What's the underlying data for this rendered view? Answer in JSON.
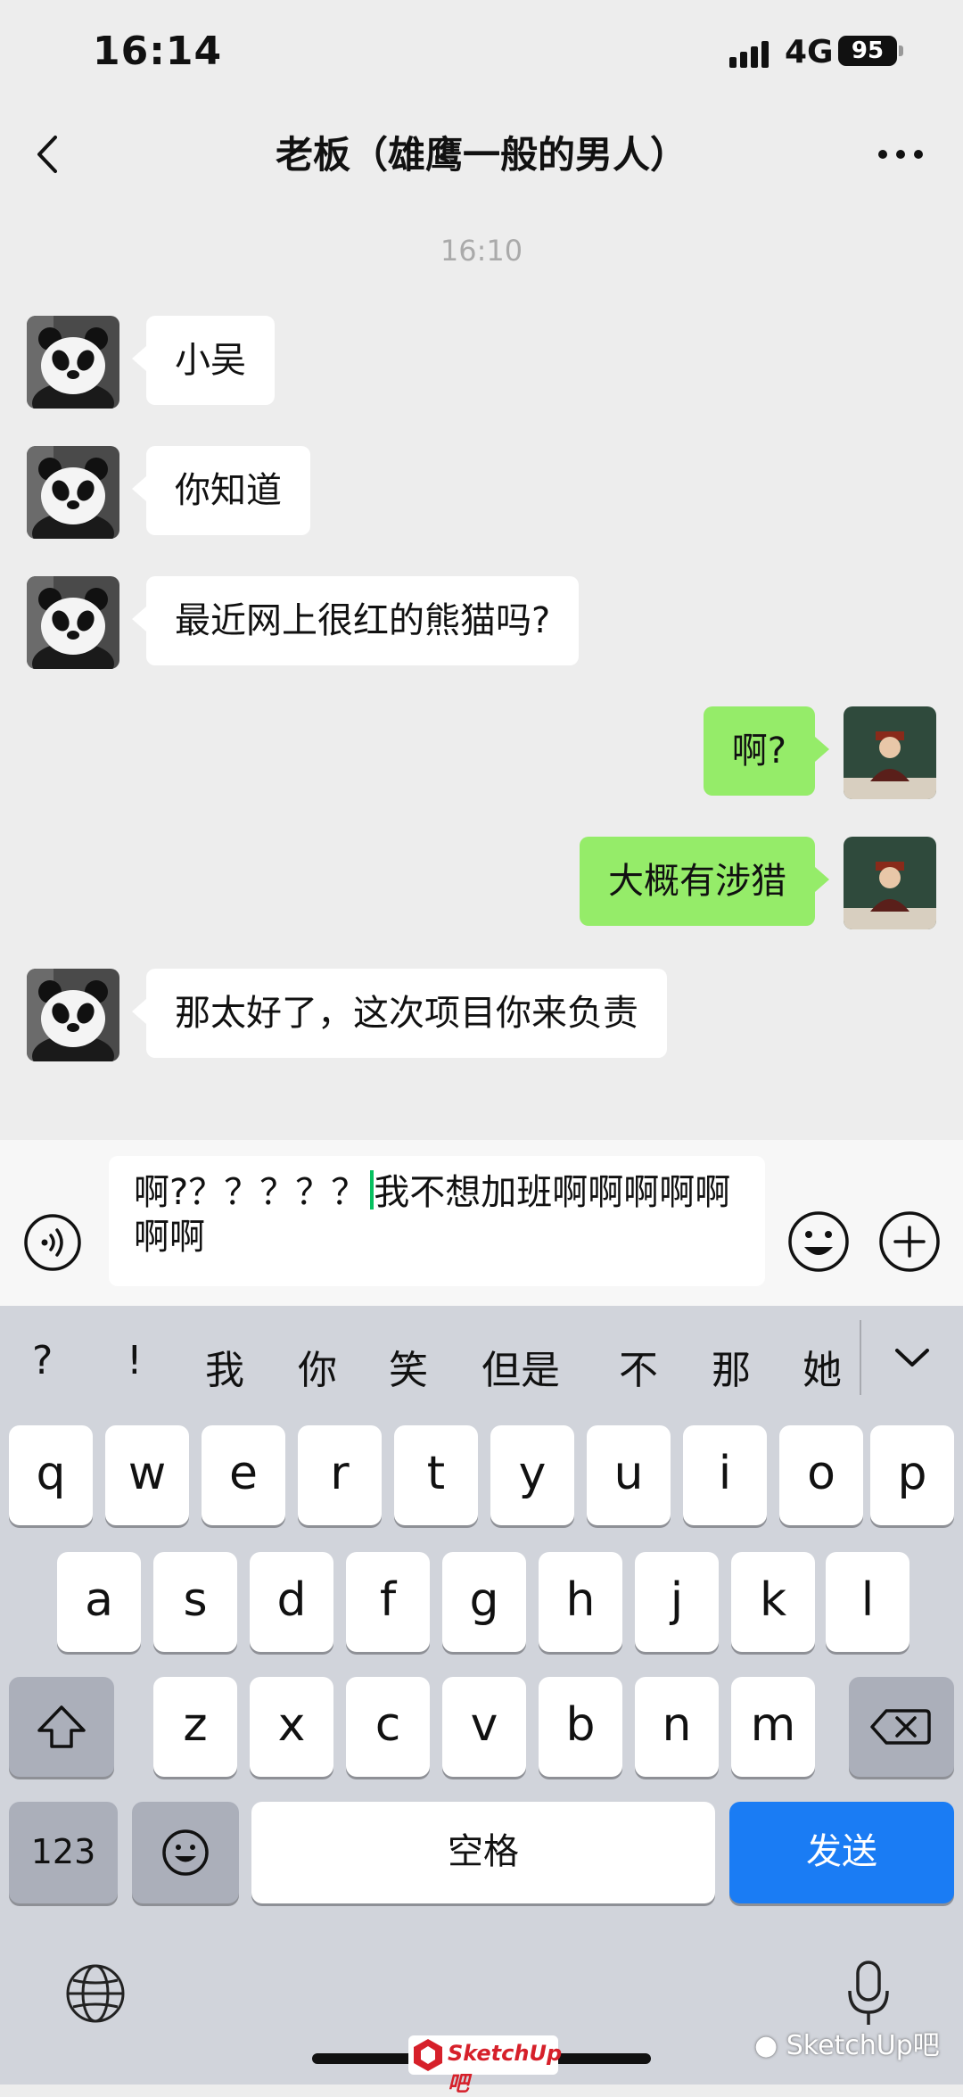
{
  "status_bar": {
    "time": "16:14",
    "network": "4G",
    "battery": "95"
  },
  "nav": {
    "title": "老板（雄鹰一般的男人）",
    "back_icon": "chevron-left-icon",
    "more_icon": "more-dots-icon"
  },
  "chat": {
    "timestamp": "16:10",
    "messages": [
      {
        "from": "contact",
        "text": "小吴"
      },
      {
        "from": "contact",
        "text": "你知道"
      },
      {
        "from": "contact",
        "text": "最近网上很红的熊猫吗?"
      },
      {
        "from": "me",
        "text": "啊?"
      },
      {
        "from": "me",
        "text": "大概有涉猎"
      },
      {
        "from": "contact",
        "text": "那太好了，这次项目你来负责"
      }
    ]
  },
  "input": {
    "before_cursor": "啊?？？？？？",
    "after_cursor": "我不想加班啊啊啊啊啊啊啊"
  },
  "keyboard": {
    "candidates": [
      "?",
      "!",
      "我",
      "你",
      "笑",
      "但是",
      "不",
      "那",
      "她"
    ],
    "row1": [
      "q",
      "w",
      "e",
      "r",
      "t",
      "y",
      "u",
      "i",
      "o",
      "p"
    ],
    "row2": [
      "a",
      "s",
      "d",
      "f",
      "g",
      "h",
      "j",
      "k",
      "l"
    ],
    "row3": [
      "z",
      "x",
      "c",
      "v",
      "b",
      "n",
      "m"
    ],
    "numbers_label": "123",
    "space_label": "空格",
    "send_label": "发送",
    "send_color": "#1a7cf4"
  },
  "watermark": {
    "logo_text": "SketchUp吧",
    "account_text": "SketchUp吧"
  },
  "colors": {
    "outgoing_bubble": "#95ec69",
    "incoming_bubble": "#ffffff",
    "background": "#ededed",
    "keyboard_bg": "#d1d4db"
  }
}
